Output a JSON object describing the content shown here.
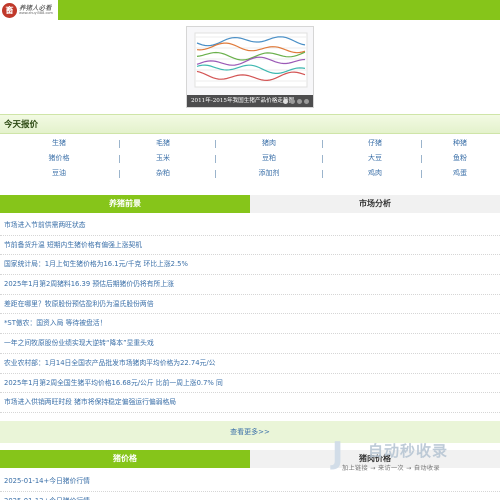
{
  "header": {
    "logo_glyph": "畜",
    "logo_name": "养猪人必看",
    "logo_url": "www.zhuyi588.com"
  },
  "slideshow": {
    "caption": "2011年-2015年我国生猪产品价格走势图",
    "pages": [
      "1",
      "2",
      "3",
      "4"
    ],
    "line_colors": [
      "#4a8fc6",
      "#e07a3a",
      "#6ab04c",
      "#9b59b6",
      "#3fb8b0",
      "#d35454"
    ]
  },
  "quotes": {
    "title": "今天报价",
    "rows": [
      [
        "生猪",
        "毛猪",
        "猪肉",
        "仔猪",
        "种猪"
      ],
      [
        "猪价格",
        "玉米",
        "豆粕",
        "大豆",
        "鱼粉"
      ],
      [
        "豆油",
        "杂粕",
        "添加剂",
        "鸡肉",
        "鸡蛋"
      ]
    ]
  },
  "tabs": {
    "left": "养猪前景",
    "right": "市场分析"
  },
  "news": [
    "市场进入节前供需两旺状态",
    "节前备货升温 短期内生猪价格有偏强上涨契机",
    "国家统计局：1月上旬生猪价格为16.1元/千克 环比上涨2.5%",
    "2025年1月第2周猪料16.39 预估后期猪价仍将有所上涨",
    "差距在哪里？牧原股份预估盈利仍为温氏股份两倍",
    "*ST傲农：国资入局 等待被盘活！",
    "一年之间牧原股份业绩实现大逆转“降本”显重头戏",
    "农业农村部：1月14日全国农产品批发市场猪肉平均价格为22.74元/公",
    "2025年1月第2周全国生猪平均价格16.68元/公斤 比前一周上涨0.7% 同",
    "市场进入供销两旺时段 猪市将保持稳定偏强运行偏弱格局"
  ],
  "more": "查看更多>>",
  "tabs2": {
    "left": "猪价格",
    "right": "猪肉价格"
  },
  "news2": [
    "2025-01-14+今日猪价行情",
    "2025-01-13+今日猪价行情"
  ],
  "watermark": {
    "mark": "J",
    "title": "自动秒收录",
    "subtitle": "加上链接 → 来访一次 → 自动收录"
  }
}
